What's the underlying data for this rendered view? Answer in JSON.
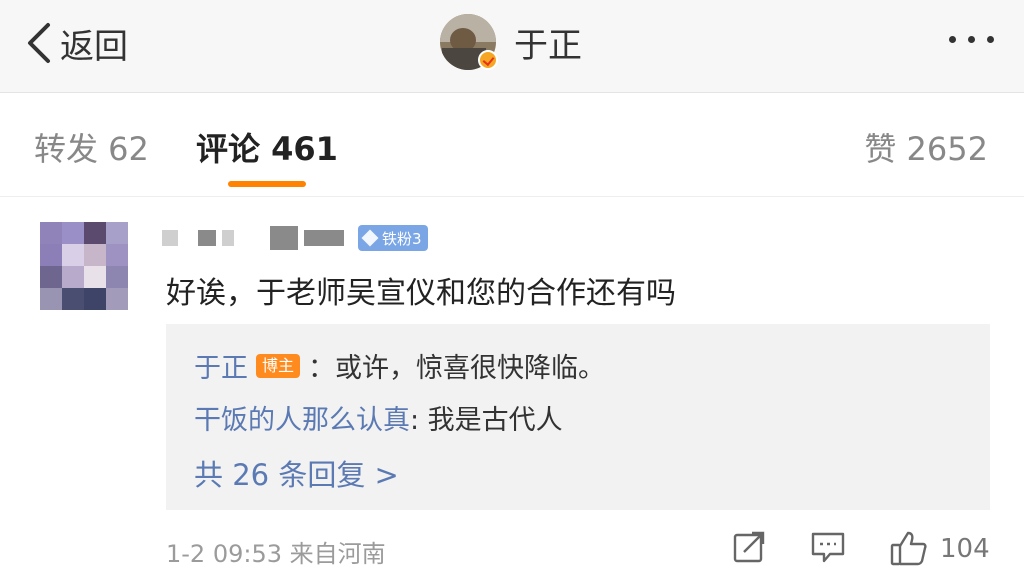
{
  "header": {
    "back_label": "返回",
    "title": "于正"
  },
  "tabs": {
    "repost": "转发 62",
    "comment": "评论 461",
    "like": "赞 2652"
  },
  "comment": {
    "fan_badge": "铁粉3",
    "text": "好诶，于老师吴宣仪和您的合作还有吗",
    "replies": [
      {
        "name": "于正",
        "badge": "博主",
        "text": "：或许，惊喜很快降临。"
      },
      {
        "name": "干饭的人那么认真",
        "text": ": 我是古代人"
      }
    ],
    "more_replies": "共 26 条回复 >",
    "time": "1-2 09:53",
    "location": "来自河南",
    "like_count": "104"
  },
  "colors": {
    "accent": "#ff8200",
    "link": "#5b7ab3",
    "fan_badge": "#7aa6e6",
    "author_badge": "#ff8a1e"
  },
  "icons": [
    "back-chevron-icon",
    "verified-icon",
    "more-icon",
    "share-icon",
    "comment-icon",
    "thumbs-up-icon"
  ]
}
